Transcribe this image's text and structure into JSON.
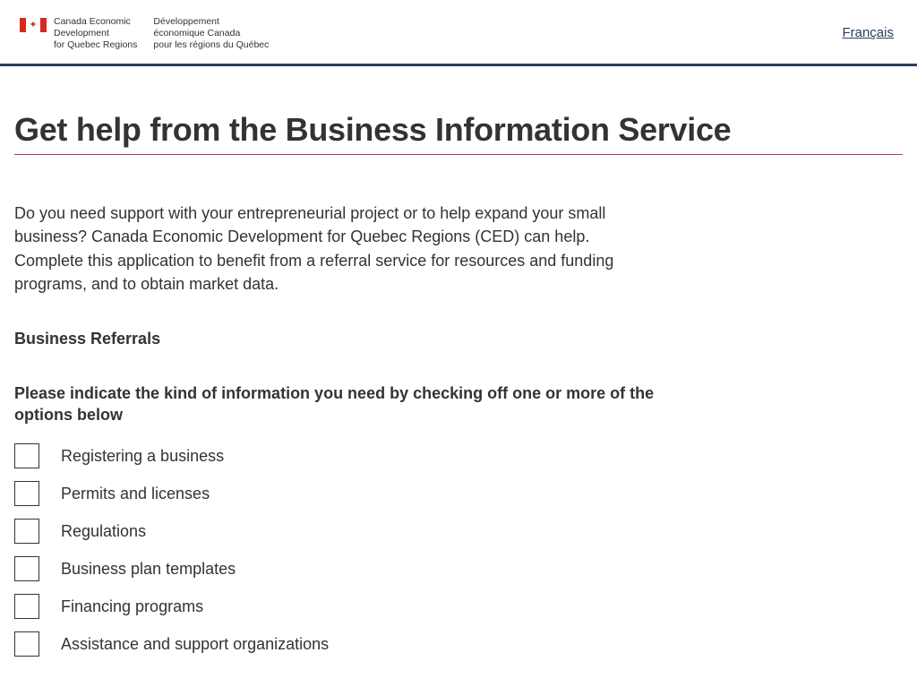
{
  "header": {
    "org_en_line1": "Canada Economic",
    "org_en_line2": "Development",
    "org_en_line3": "for Quebec Regions",
    "org_fr_line1": "Développement",
    "org_fr_line2": "économique Canada",
    "org_fr_line3": "pour les régions du Québec",
    "language_toggle": "Français"
  },
  "main": {
    "title": "Get help from the Business Information Service",
    "intro": "Do you need support with your entrepreneurial project or to help expand your small business? Canada Economic Development for Quebec Regions (CED) can help. Complete this application to benefit from a referral service for resources and funding programs, and to obtain market data.",
    "section_heading": "Business Referrals",
    "question": "Please indicate the kind of information you need by checking off one or more of the options below",
    "options": [
      "Registering a business",
      "Permits and licenses",
      "Regulations",
      "Business plan templates",
      "Financing programs",
      "Assistance and support organizations"
    ]
  }
}
